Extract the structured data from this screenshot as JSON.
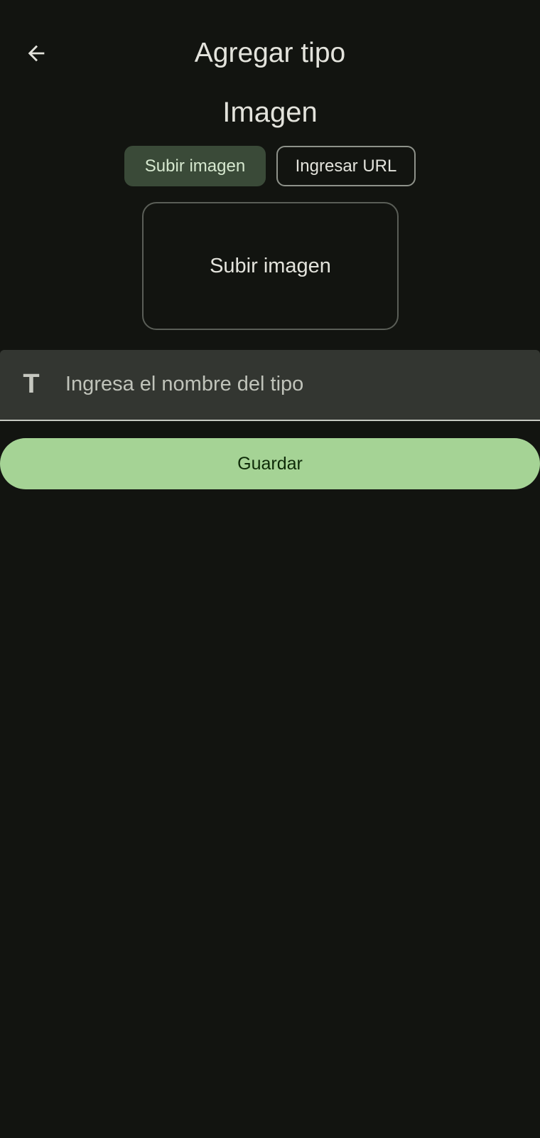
{
  "header": {
    "back_icon": "arrow-left-icon",
    "title": "Agregar tipo"
  },
  "image_section": {
    "title": "Imagen",
    "options": [
      {
        "label": "Subir imagen",
        "selected": true
      },
      {
        "label": "Ingresar URL",
        "selected": false
      }
    ],
    "upload_box_label": "Subir imagen"
  },
  "name_field": {
    "icon": "text-format-icon",
    "icon_glyph": "T",
    "placeholder": "Ingresa el nombre del tipo",
    "value": ""
  },
  "save_button": {
    "label": "Guardar"
  },
  "colors": {
    "background": "#121410",
    "accent": "#a5d395",
    "selected_segment": "#3a4a38"
  }
}
